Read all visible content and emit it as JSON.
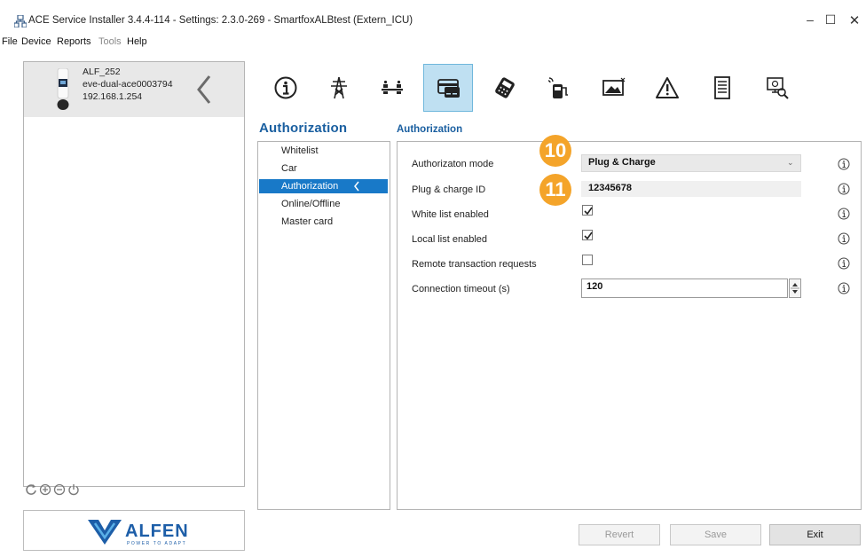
{
  "window": {
    "title": "ACE Service Installer 3.4.4-114 - Settings: 2.3.0-269 - SmartfoxALBtest (Extern_ICU)",
    "minimize_glyph": "–",
    "maximize_glyph": "☐",
    "close_glyph": "✕"
  },
  "menu": {
    "file": "File",
    "device": "Device",
    "reports": "Reports",
    "tools": "Tools",
    "help": "Help"
  },
  "device": {
    "name": "ALF_252",
    "model": "eve-dual-ace0003794",
    "ip": "192.168.1.254"
  },
  "bottom_controls": [
    "refresh-icon",
    "zoom-in-icon",
    "zoom-out-icon",
    "power-icon"
  ],
  "logo": {
    "brand": "ALFEN",
    "tagline": "POWER TO ADAPT"
  },
  "toolbar": {
    "icons": [
      "info-icon",
      "power-grid-icon",
      "balance-icon",
      "card-icon",
      "payment-terminal-icon",
      "charger-icon",
      "image-icon",
      "warning-icon",
      "document-icon",
      "diagnostics-icon"
    ],
    "selected": "card-icon"
  },
  "section": {
    "heading": "Authorization",
    "subheading": "Authorization"
  },
  "nav": {
    "items": [
      "Whitelist",
      "Car",
      "Authorization",
      "Online/Offline",
      "Master card"
    ],
    "selected": "Authorization"
  },
  "form": {
    "auth_mode_label": "Authorizaton mode",
    "auth_mode_value": "Plug & Charge",
    "pc_id_label": "Plug & charge ID",
    "pc_id_value": "12345678",
    "whitelist_label": "White list enabled",
    "whitelist_checked": true,
    "locallist_label": "Local list enabled",
    "locallist_checked": true,
    "remote_label": "Remote transaction requests",
    "remote_checked": false,
    "timeout_label": "Connection timeout (s)",
    "timeout_value": "120"
  },
  "callouts": {
    "c10": "10",
    "c11": "11"
  },
  "buttons": {
    "revert": "Revert",
    "save": "Save",
    "exit": "Exit"
  },
  "colors": {
    "accent": "#1879c8",
    "heading": "#1a5fa0",
    "callout": "#f4a42a",
    "selected_tool": "#bfe0f2"
  }
}
